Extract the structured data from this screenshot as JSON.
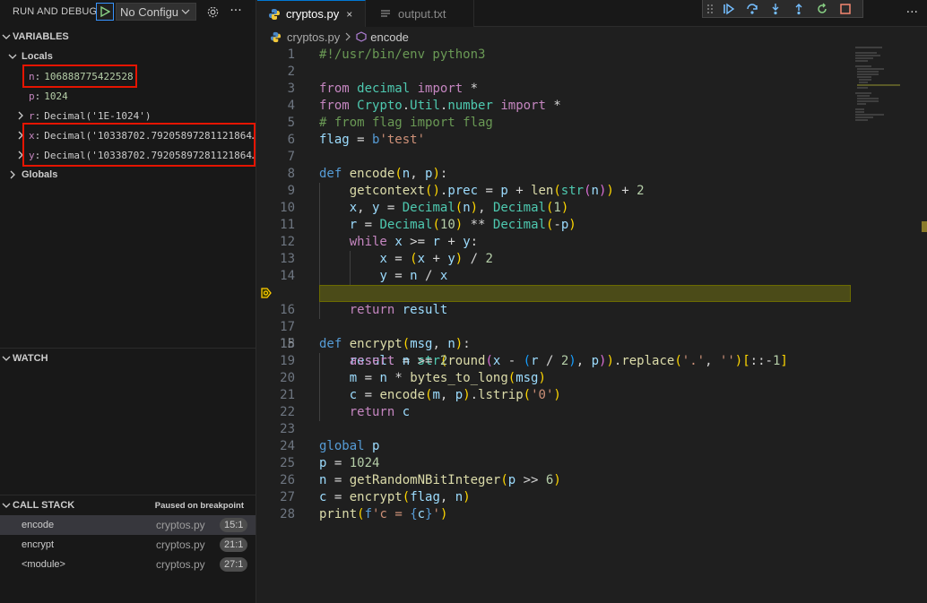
{
  "sidebar": {
    "title": "RUN AND DEBUG",
    "config": "No Configu",
    "variables_label": "VARIABLES",
    "locals_label": "Locals",
    "globals_label": "Globals",
    "locals": [
      {
        "name": "n",
        "value": "106888775422528",
        "expandable": false,
        "kind": "num"
      },
      {
        "name": "p",
        "value": "1024",
        "expandable": false,
        "kind": "num"
      },
      {
        "name": "r",
        "value": "Decimal('1E-1024')",
        "expandable": true,
        "kind": "str"
      },
      {
        "name": "x",
        "value": "Decimal('10338702.79205897281121864…",
        "expandable": true,
        "kind": "str"
      },
      {
        "name": "y",
        "value": "Decimal('10338702.79205897281121864…",
        "expandable": true,
        "kind": "str"
      }
    ],
    "watch_label": "WATCH",
    "callstack_label": "CALL STACK",
    "callstack_status": "Paused on breakpoint",
    "callstack": [
      {
        "name": "encode",
        "file": "cryptos.py",
        "line": "15:1"
      },
      {
        "name": "encrypt",
        "file": "cryptos.py",
        "line": "21:1"
      },
      {
        "name": "<module>",
        "file": "cryptos.py",
        "line": "27:1"
      }
    ]
  },
  "tabs": [
    {
      "label": "cryptos.py",
      "active": true,
      "close": "×"
    },
    {
      "label": "output.txt",
      "active": false
    }
  ],
  "breadcrumb": {
    "file": "cryptos.py",
    "symbol": "encode"
  },
  "editor": {
    "current_line": 15,
    "line_numbers": [
      "1",
      "2",
      "3",
      "4",
      "5",
      "6",
      "7",
      "8",
      "9",
      "10",
      "11",
      "12",
      "13",
      "14",
      "15",
      "16",
      "17",
      "18",
      "19",
      "20",
      "21",
      "22",
      "23",
      "24",
      "25",
      "26",
      "27",
      "28"
    ]
  },
  "colors": {
    "accent": "#0078d4",
    "highlight_box": "#e51400",
    "current_line_bg": "#4b4b18",
    "breakpoint_arrow": "#ffcc00"
  }
}
